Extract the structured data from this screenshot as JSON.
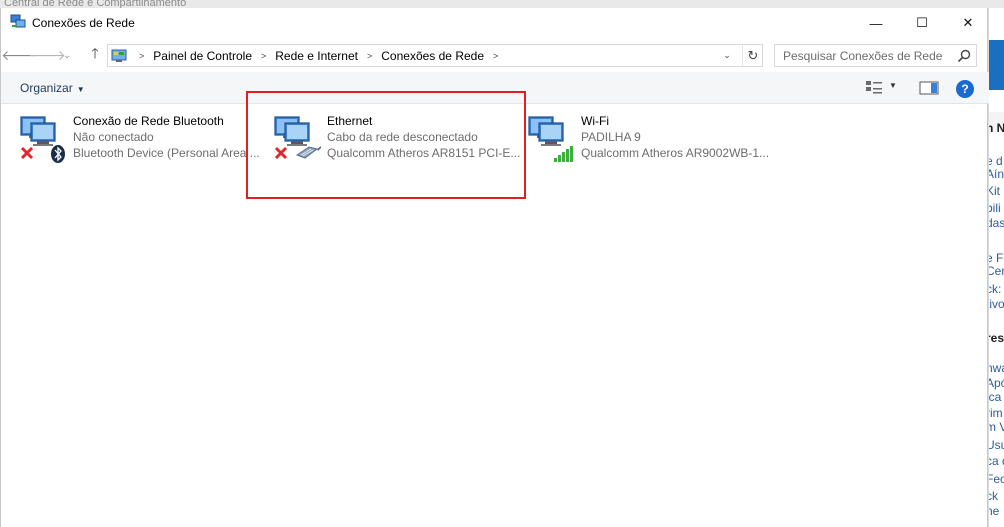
{
  "background": {
    "window_title": "Central de Rede e Compartilhamento",
    "side_fragments": [
      {
        "text": "n N",
        "bold": true
      },
      {
        "text": "e d"
      },
      {
        "text": "Aín"
      },
      {
        "text": "Kit"
      },
      {
        "text": "bili"
      },
      {
        "text": "das"
      },
      {
        "text": "e F"
      },
      {
        "text": "Cen"
      },
      {
        "text": "ck:"
      },
      {
        "text": "tivo"
      },
      {
        "text": "res",
        "bold": true
      },
      {
        "text": "nwa"
      },
      {
        "text": "Apó"
      },
      {
        "text": "ica"
      },
      {
        "text": "rim"
      },
      {
        "text": "m V"
      },
      {
        "text": "Usu"
      },
      {
        "text": "ca d"
      },
      {
        "text": "Fec"
      },
      {
        "text": "ck"
      },
      {
        "text": "ne"
      }
    ]
  },
  "window": {
    "title": "Conexões de Rede",
    "controls": {
      "minimize": "—",
      "maximize": "☐",
      "close": "✕"
    }
  },
  "address": {
    "crumbs": [
      "Painel de Controle",
      "Rede e Internet",
      "Conexões de Rede"
    ],
    "search_placeholder": "Pesquisar Conexões de Rede"
  },
  "toolbar": {
    "organize_label": "Organizar",
    "help_label": "?"
  },
  "connections": [
    {
      "name": "Conexão de Rede Bluetooth",
      "status": "Não conectado",
      "device": "Bluetooth Device (Personal Area ...",
      "icon": "bluetooth-network-icon",
      "state": "disconnected"
    },
    {
      "name": "Ethernet",
      "status": "Cabo da rede desconectado",
      "device": "Qualcomm Atheros AR8151 PCI-E...",
      "icon": "ethernet-network-icon",
      "state": "disconnected"
    },
    {
      "name": "Wi-Fi",
      "status": "PADILHA  9",
      "device": "Qualcomm Atheros AR9002WB-1...",
      "icon": "wifi-network-icon",
      "state": "connected"
    }
  ],
  "colors": {
    "highlight": "#e21d24",
    "help": "#1a6ad1",
    "error_x": "#e2262b",
    "signal": "#3cae3c"
  }
}
